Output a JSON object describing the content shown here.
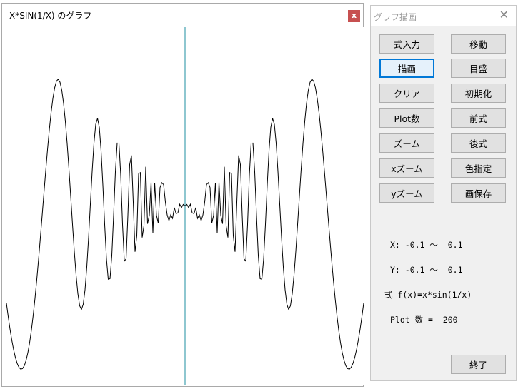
{
  "graph_window": {
    "title": "X*SIN(1/X) のグラフ",
    "close_glyph": "x"
  },
  "panel": {
    "title": "グラフ描画",
    "close_glyph": "✕",
    "buttons": {
      "formula_input": "式入力",
      "move": "移動",
      "draw": "描画",
      "scale": "目盛",
      "clear": "クリア",
      "initialize": "初期化",
      "plot_count": "Plot数",
      "prev_formula": "前式",
      "zoom": "ズーム",
      "next_formula": "後式",
      "x_zoom": "xズーム",
      "color": "色指定",
      "y_zoom": "yズーム",
      "save_image": "画保存",
      "exit": "終了"
    },
    "info": {
      "x_range": "X: -0.1 ～  0.1",
      "y_range": "Y: -0.1 ～  0.1",
      "formula": "式 f(x)=x*sin(1/x)",
      "plot_count": "Plot 数 =  200"
    }
  },
  "chart_data": {
    "type": "line",
    "function": "x*sin(1/x)",
    "xlim": [
      -0.1,
      0.1
    ],
    "ylim": [
      -0.1,
      0.1
    ],
    "plot_points": 200,
    "axis_color": "#1e8fa0",
    "line_color": "#000000"
  }
}
